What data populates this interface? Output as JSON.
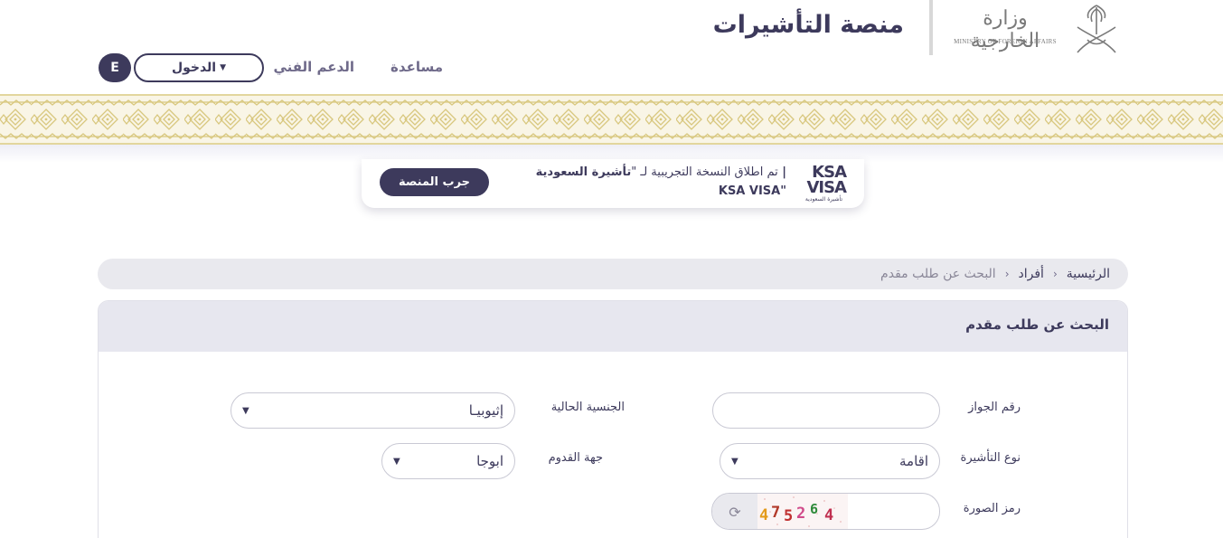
{
  "header": {
    "logo_ar": "وزارة الخارجية",
    "logo_en": "MINISTRY OF FOREIGN AFFAIRS",
    "platform_title": "منصة التأشيرات",
    "nav_help": "مساعدة",
    "nav_support": "الدعم الفني",
    "login_label": "الدخول",
    "lang_label": "E"
  },
  "banner": {
    "logo_line1": "KSA",
    "logo_line2": "VISA",
    "logo_line3": "تأشيرة السعودية",
    "text_prefix": "تم اطلاق النسخة التجريبية لـ \"",
    "text_bold": "تأشيرة السعودية |",
    "text_suffix": "KSA VISA\"",
    "try_button": "جرب المنصة"
  },
  "breadcrumb": {
    "home": "الرئيسية",
    "individuals": "أفراد",
    "current": "البحث عن طلب مقدم",
    "separator": "›"
  },
  "form": {
    "title": "البحث عن طلب مقدم",
    "passport_label": "رقم الجواز",
    "passport_value": "",
    "nationality_label": "الجنسية الحالية",
    "nationality_value": "إثيوبيـا",
    "visa_type_label": "نوع التأشيرة",
    "visa_type_value": "اقامة",
    "arrival_label": "جهة القدوم",
    "arrival_value": "ابوجا",
    "captcha_label": "رمز الصورة",
    "captcha_text": "475264",
    "captcha_value": ""
  },
  "colors": {
    "primary": "#3d3a5c",
    "pattern_gold": "#e2d69d",
    "panel_gray": "#e7e7ef"
  },
  "icons": {
    "refresh": "refresh-icon",
    "chevron": "chevron-down-icon",
    "caret": "caret-down-icon"
  }
}
